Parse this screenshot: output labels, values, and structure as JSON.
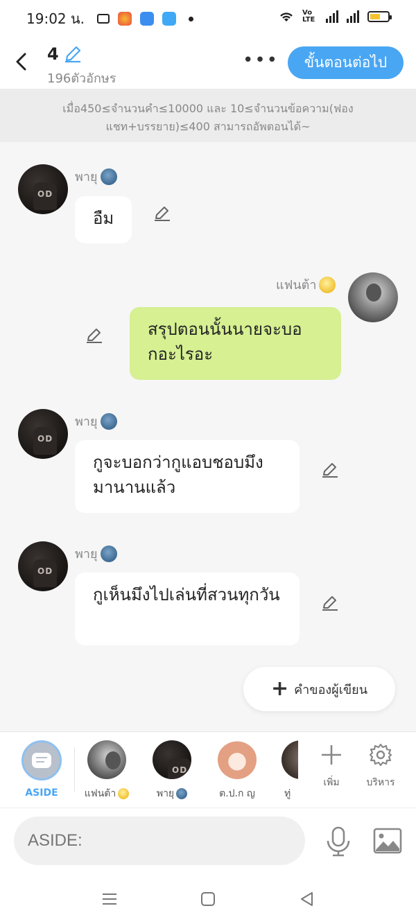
{
  "status": {
    "time": "19:02 น.",
    "network": "Vo LTE"
  },
  "header": {
    "title": "4",
    "subtitle": "196ตัวอักษร",
    "more": "•••",
    "next_button": "ขั้นตอนต่อไป"
  },
  "notice": "เมื่อ450≤จำนวนคำ≤10000 และ 10≤จำนวนข้อความ(ฟองแชท+บรรยาย)≤400 สามารถอัพตอนได้~",
  "messages": [
    {
      "sender": "พายุ",
      "text": "อืม",
      "side": "left"
    },
    {
      "sender": "แฟนต้า",
      "text": "สรุปตอนนั้นนายจะบอกอะไรอะ",
      "side": "right"
    },
    {
      "sender": "พายุ",
      "text": "กูจะบอกว่ากูแอบชอบมึงมานานแล้ว",
      "side": "left"
    },
    {
      "sender": "พายุ",
      "text": "กูเห็นมึงไปเล่นที่สวนทุกวัน",
      "side": "left"
    }
  ],
  "author_note_button": "คำของผู้เขียน",
  "characters": [
    {
      "label": "ASIDE"
    },
    {
      "label": "แฟนต้า"
    },
    {
      "label": "พายุ"
    },
    {
      "label": "ต.ป.ก ญ"
    },
    {
      "label": "ทู่"
    }
  ],
  "actions": {
    "add": "เพิ่ม",
    "manage": "บริหาร"
  },
  "input": {
    "placeholder": "ASIDE:"
  },
  "colors": {
    "accent": "#49a6f3",
    "right_bubble": "#d6f092",
    "background": "#f6f6f6"
  }
}
